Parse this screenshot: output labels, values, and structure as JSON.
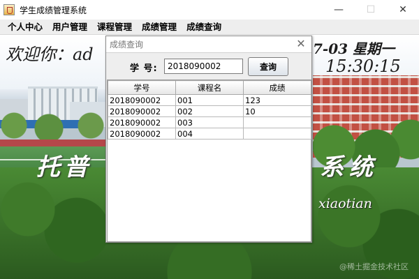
{
  "window": {
    "title": "学生成绩管理系统",
    "controls": {
      "minimize": "—",
      "maximize": "☐",
      "close": "✕"
    }
  },
  "menu": {
    "items": [
      "个人中心",
      "用户管理",
      "课程管理",
      "成绩管理",
      "成绩查询"
    ]
  },
  "background": {
    "welcome": "欢迎你：ad",
    "date": "7-03 星期一",
    "time": "15:30:15",
    "system_left": "托普",
    "system_right": "系统",
    "author": "xiaotian",
    "watermark": "@稀土掘金技术社区"
  },
  "dialog": {
    "title": "成绩查询",
    "close_icon": "close-icon",
    "search": {
      "label": "学 号:",
      "value": "2018090002",
      "button": "查询"
    },
    "table": {
      "headers": [
        "学号",
        "课程名",
        "成绩"
      ],
      "rows": [
        [
          "2018090002",
          "001",
          "123"
        ],
        [
          "2018090002",
          "002",
          "10"
        ],
        [
          "2018090002",
          "003",
          ""
        ],
        [
          "2018090002",
          "004",
          ""
        ]
      ]
    }
  }
}
